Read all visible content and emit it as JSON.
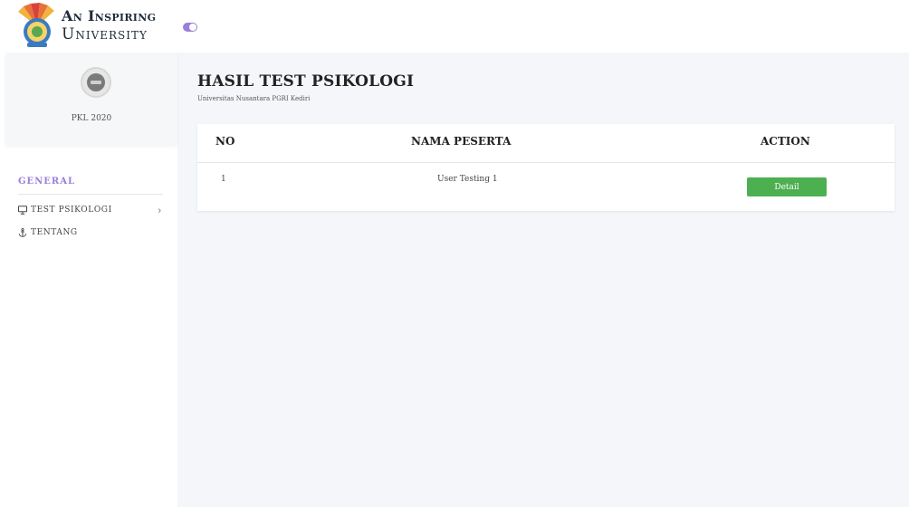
{
  "header": {
    "logo_line1": "An Inspiring",
    "logo_line2": "University",
    "toggle_state": "on"
  },
  "sidebar": {
    "profile_name": "PKL 2020",
    "section_title": "GENERAL",
    "items": [
      {
        "label": "TEST PSIKOLOGI",
        "icon": "monitor-icon",
        "has_submenu": true
      },
      {
        "label": "TENTANG",
        "icon": "anchor-icon",
        "has_submenu": false
      }
    ]
  },
  "main": {
    "title": "HASIL TEST PSIKOLOGI",
    "subtitle": "Universitas Nusantara PGRI Kediri",
    "table": {
      "columns": [
        "NO",
        "NAMA PESERTA",
        "ACTION"
      ],
      "rows": [
        {
          "no": "1",
          "nama": "User Testing 1",
          "action": "Detail"
        }
      ]
    }
  },
  "colors": {
    "accent": "#9b7fd9",
    "button": "#4caf50",
    "background": "#f4f6f9"
  }
}
